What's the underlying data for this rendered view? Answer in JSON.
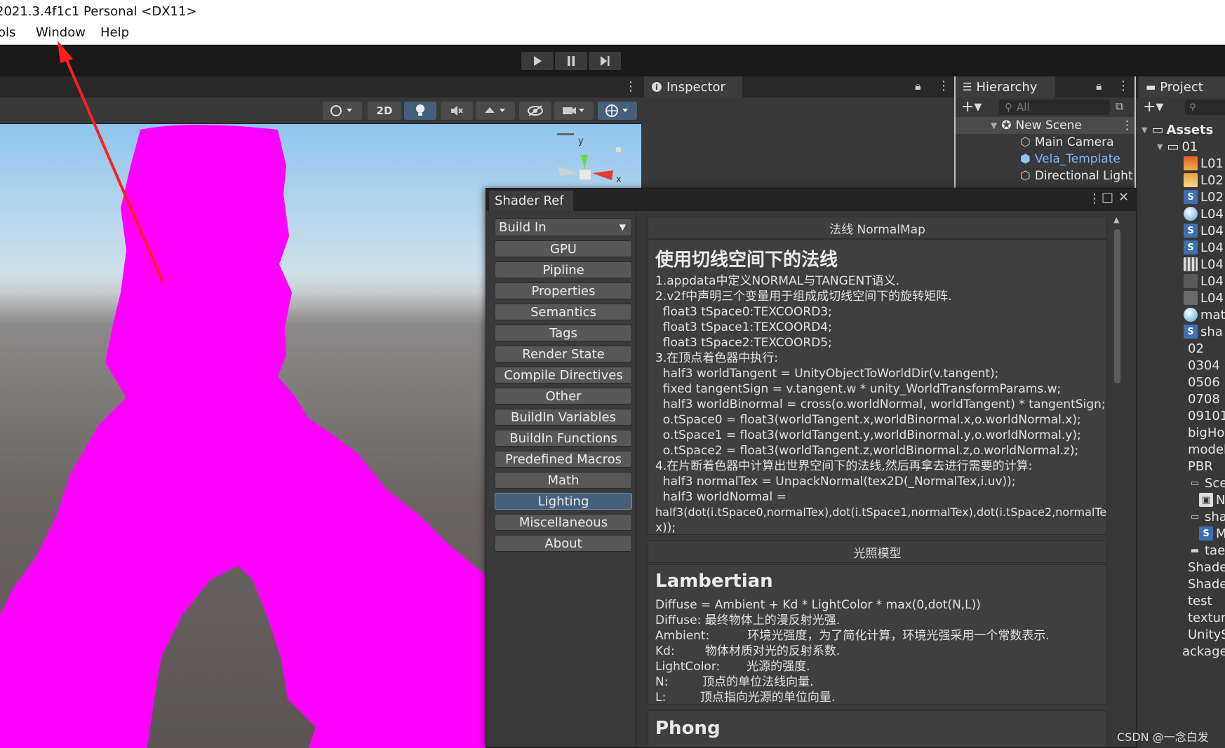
{
  "window": {
    "title": "2021.3.4f1c1 Personal <DX11>"
  },
  "menu": {
    "items": [
      "Tools",
      "Window",
      "Help"
    ]
  },
  "scene": {
    "mode_2d": "2D",
    "gizmo_axis_y": "y",
    "gizmo_axis_x": "x"
  },
  "inspector": {
    "tab": "Inspector"
  },
  "hierarchy": {
    "tab": "Hierarchy",
    "search_placeholder": "All",
    "scene_name": "New Scene",
    "objects": [
      "Main Camera",
      "Vela_Template",
      "Directional Light"
    ]
  },
  "project": {
    "tab": "Project",
    "root": "Assets",
    "folder": "01",
    "items": [
      "L01",
      "L02",
      "L02",
      "L04",
      "L04",
      "L04",
      "L04",
      "L04",
      "L04",
      "mat",
      "sha",
      "02",
      "0304",
      "0506",
      "0708",
      "09101",
      "bigHo",
      "model",
      "PBR",
      "Sce",
      "N",
      "sha",
      "M",
      "taec",
      "Shade",
      "Shade",
      "test",
      "textur",
      "UnityS",
      "ackage"
    ]
  },
  "shader_ref": {
    "tab": "Shader Ref",
    "dropdown": "Build In",
    "nav": [
      "GPU",
      "Pipline",
      "Properties",
      "Semantics",
      "Tags",
      "Render State",
      "Compile Directives",
      "Other",
      "BuildIn Variables",
      "BuildIn Functions",
      "Predefined Macros",
      "Math",
      "Lighting",
      "Miscellaneous",
      "About"
    ],
    "active_nav": "Lighting",
    "section1": {
      "header": "法线 NormalMap",
      "title": "使用切线空间下的法线",
      "lines": [
        "1.appdata中定义NORMAL与TANGENT语义.",
        "2.v2f中声明三个变量用于组成成切线空间下的旋转矩阵.",
        "  float3 tSpace0:TEXCOORD3;",
        "  float3 tSpace1:TEXCOORD4;",
        "  float3 tSpace2:TEXCOORD5;",
        "3.在顶点着色器中执行:",
        "  half3 worldTangent = UnityObjectToWorldDir(v.tangent);",
        "  fixed tangentSign = v.tangent.w * unity_WorldTransformParams.w;",
        "  half3 worldBinormal = cross(o.worldNormal, worldTangent) * tangentSign;",
        "  o.tSpace0 = float3(worldTangent.x,worldBinormal.x,o.worldNormal.x);",
        "  o.tSpace1 = float3(worldTangent.y,worldBinormal.y,o.worldNormal.y);",
        "  o.tSpace2 = float3(worldTangent.z,worldBinormal.z,o.worldNormal.z);",
        "4.在片断着色器中计算出世界空间下的法线,然后再拿去进行需要的计算:",
        "  half3 normalTex = UnpackNormal(tex2D(_NormalTex,i.uv));",
        "  half3 worldNormal =",
        "half3(dot(i.tSpace0,normalTex),dot(i.tSpace1,normalTex),dot(i.tSpace2,normalTe",
        "x));"
      ]
    },
    "section2": {
      "header": "光照模型",
      "title": "Lambertian",
      "lines": [
        "Diffuse = Ambient + Kd * LightColor * max(0,dot(N,L))",
        "Diffuse: 最终物体上的漫反射光强.",
        "Ambient:          环境光强度，为了简化计算，环境光强采用一个常数表示.",
        "Kd:        物体材质对光的反射系数.",
        "LightColor:       光源的强度.",
        "N:         顶点的单位法线向量.",
        "L:         顶点指向光源的单位向量."
      ]
    },
    "section3": {
      "title": "Phong"
    }
  },
  "watermark": "CSDN @一念白发",
  "colors": {
    "magenta": "#ff00ff",
    "accent": "#46607c",
    "link": "#7fb4ff"
  }
}
